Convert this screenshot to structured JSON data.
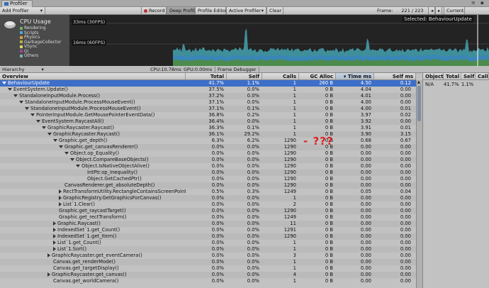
{
  "window": {
    "tab_title": "Profiler"
  },
  "toolbar": {
    "add_profiler": "Add Profiler",
    "record": "Record",
    "deep_profile": "Deep Profile",
    "profile_editor": "Profile Editor",
    "active_profiler": "Active Profiler",
    "clear": "Clear",
    "frame_label": "Frame:",
    "frame_value": "221 / 223",
    "current": "Current"
  },
  "graph": {
    "title": "CPU Usage",
    "legend": [
      {
        "label": "Rendering",
        "color": "#6bb36b"
      },
      {
        "label": "Scripts",
        "color": "#4fa8d8"
      },
      {
        "label": "Physics",
        "color": "#d8a040"
      },
      {
        "label": "GarbageCollector",
        "color": "#b8b040"
      },
      {
        "label": "VSync",
        "color": "#d8d860"
      },
      {
        "label": "Gi",
        "color": "#9a4a9a"
      },
      {
        "label": "Others",
        "color": "#7ab0b8"
      }
    ],
    "line_30fps": "33ms (30FPS)",
    "line_60fps": "16ms (60FPS)",
    "selected": "Selected: BehaviourUpdate"
  },
  "status": {
    "view": "Hierarchy",
    "cpu": "CPU:10.78ms",
    "gpu": "GPU:0.00ms",
    "frame_debugger": "Frame Debugger"
  },
  "columns": [
    "Overview",
    "Total",
    "Self",
    "Calls",
    "GC Alloc",
    "Time ms",
    "Self ms"
  ],
  "right_columns": [
    "Object",
    "Total",
    "Self",
    "Call"
  ],
  "right_row": [
    "N/A",
    "41.7%",
    "1.1%"
  ],
  "annotation": "- ???",
  "rows": [
    {
      "name": "BehaviourUpdate",
      "total": "41.7%",
      "self": "1.1%",
      "calls": "1",
      "gc": "260 B",
      "time": "4.50",
      "selfms": "0.12"
    },
    {
      "name": "EventSystem.Update()",
      "total": "37.5%",
      "self": "0.0%",
      "calls": "1",
      "gc": "0 B",
      "time": "4.04",
      "selfms": "0.00"
    },
    {
      "name": "StandaloneInputModule.Process()",
      "total": "37.2%",
      "self": "0.0%",
      "calls": "1",
      "gc": "0 B",
      "time": "4.01",
      "selfms": "0.00"
    },
    {
      "name": "StandaloneInputModule.ProcessMouseEvent()",
      "total": "37.1%",
      "self": "0.0%",
      "calls": "1",
      "gc": "0 B",
      "time": "4.00",
      "selfms": "0.00"
    },
    {
      "name": "StandaloneInputModule.ProcessMouseEvent()",
      "total": "37.1%",
      "self": "0.1%",
      "calls": "1",
      "gc": "0 B",
      "time": "4.00",
      "selfms": "0.01"
    },
    {
      "name": "PointerInputModule.GetMousePointerEventData()",
      "total": "36.8%",
      "self": "0.2%",
      "calls": "1",
      "gc": "0 B",
      "time": "3.97",
      "selfms": "0.02"
    },
    {
      "name": "EventSystem.RaycastAll()",
      "total": "36.4%",
      "self": "0.0%",
      "calls": "1",
      "gc": "0 B",
      "time": "3.92",
      "selfms": "0.00"
    },
    {
      "name": "GraphicRaycaster.Raycast()",
      "total": "36.3%",
      "self": "0.1%",
      "calls": "1",
      "gc": "0 B",
      "time": "3.91",
      "selfms": "0.01"
    },
    {
      "name": "GraphicRaycaster.Raycast()",
      "total": "36.1%",
      "self": "29.2%",
      "calls": "1",
      "gc": "0 B",
      "time": "3.90",
      "selfms": "3.15"
    },
    {
      "name": "Graphic.get_depth()",
      "total": "6.3%",
      "self": "6.2%",
      "calls": "1290",
      "gc": "0 B",
      "time": "0.68",
      "selfms": "0.67"
    },
    {
      "name": "Graphic.get_canvasRenderer()",
      "total": "0.0%",
      "self": "0.0%",
      "calls": "1290",
      "gc": "0 B",
      "time": "0.00",
      "selfms": "0.00"
    },
    {
      "name": "Object.op_Equality()",
      "total": "0.0%",
      "self": "0.0%",
      "calls": "1290",
      "gc": "0 B",
      "time": "0.00",
      "selfms": "0.00"
    },
    {
      "name": "Object.CompareBaseObjects()",
      "total": "0.0%",
      "self": "0.0%",
      "calls": "1290",
      "gc": "0 B",
      "time": "0.00",
      "selfms": "0.00"
    },
    {
      "name": "Object.IsNativeObjectAlive()",
      "total": "0.0%",
      "self": "0.0%",
      "calls": "1290",
      "gc": "0 B",
      "time": "0.00",
      "selfms": "0.00"
    },
    {
      "name": "IntPtr.op_Inequality()",
      "total": "0.0%",
      "self": "0.0%",
      "calls": "1290",
      "gc": "0 B",
      "time": "0.00",
      "selfms": "0.00"
    },
    {
      "name": "Object.GetCachedPtr()",
      "total": "0.0%",
      "self": "0.0%",
      "calls": "1290",
      "gc": "0 B",
      "time": "0.00",
      "selfms": "0.00"
    },
    {
      "name": "CanvasRenderer.get_absoluteDepth()",
      "total": "0.0%",
      "self": "0.0%",
      "calls": "1290",
      "gc": "0 B",
      "time": "0.00",
      "selfms": "0.00"
    },
    {
      "name": "RectTransformUtility.RectangleContainsScreenPoint",
      "total": "0.5%",
      "self": "0.3%",
      "calls": "1249",
      "gc": "0 B",
      "time": "0.05",
      "selfms": "0.04"
    },
    {
      "name": "GraphicRegistry.GetGraphicsForCanvas()",
      "total": "0.0%",
      "self": "0.0%",
      "calls": "1",
      "gc": "0 B",
      "time": "0.00",
      "selfms": "0.00"
    },
    {
      "name": "List`1.Clear()",
      "total": "0.0%",
      "self": "0.0%",
      "calls": "2",
      "gc": "0 B",
      "time": "0.00",
      "selfms": "0.00"
    },
    {
      "name": "Graphic.get_raycastTarget()",
      "total": "0.0%",
      "self": "0.0%",
      "calls": "1290",
      "gc": "0 B",
      "time": "0.00",
      "selfms": "0.00"
    },
    {
      "name": "Graphic.get_rectTransform()",
      "total": "0.0%",
      "self": "0.0%",
      "calls": "1249",
      "gc": "0 B",
      "time": "0.00",
      "selfms": "0.00"
    },
    {
      "name": "Graphic.Raycast()",
      "total": "0.0%",
      "self": "0.0%",
      "calls": "11",
      "gc": "0 B",
      "time": "0.00",
      "selfms": "0.00"
    },
    {
      "name": "IndexedSet`1.get_Count()",
      "total": "0.0%",
      "self": "0.0%",
      "calls": "1291",
      "gc": "0 B",
      "time": "0.00",
      "selfms": "0.00"
    },
    {
      "name": "IndexedSet`1.get_Item()",
      "total": "0.0%",
      "self": "0.0%",
      "calls": "1290",
      "gc": "0 B",
      "time": "0.00",
      "selfms": "0.00"
    },
    {
      "name": "List`1.get_Count()",
      "total": "0.0%",
      "self": "0.0%",
      "calls": "1",
      "gc": "0 B",
      "time": "0.00",
      "selfms": "0.00"
    },
    {
      "name": "List`1.Sort()",
      "total": "0.0%",
      "self": "0.0%",
      "calls": "1",
      "gc": "0 B",
      "time": "0.00",
      "selfms": "0.00"
    },
    {
      "name": "GraphicRaycaster.get_eventCamera()",
      "total": "0.0%",
      "self": "0.0%",
      "calls": "3",
      "gc": "0 B",
      "time": "0.00",
      "selfms": "0.00"
    },
    {
      "name": "Canvas.get_renderMode()",
      "total": "0.0%",
      "self": "0.0%",
      "calls": "1",
      "gc": "0 B",
      "time": "0.00",
      "selfms": "0.00"
    },
    {
      "name": "Canvas.get_targetDisplay()",
      "total": "0.0%",
      "self": "0.0%",
      "calls": "1",
      "gc": "0 B",
      "time": "0.00",
      "selfms": "0.00"
    },
    {
      "name": "GraphicRaycaster.get_canvas()",
      "total": "0.0%",
      "self": "0.0%",
      "calls": "4",
      "gc": "0 B",
      "time": "0.00",
      "selfms": "0.00"
    },
    {
      "name": "Canvas.get_worldCamera()",
      "total": "0.0%",
      "self": "0.0%",
      "calls": "1",
      "gc": "0 B",
      "time": "0.00",
      "selfms": "0.00"
    }
  ]
}
